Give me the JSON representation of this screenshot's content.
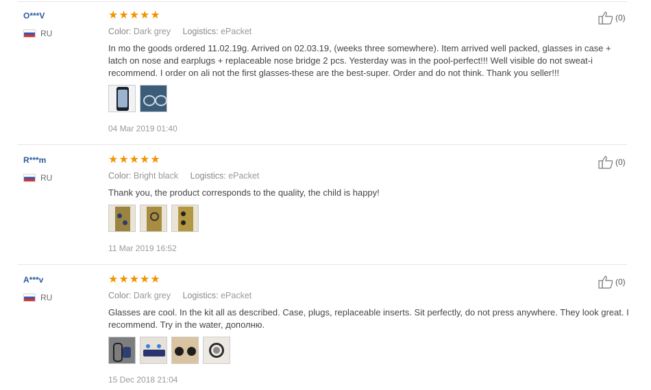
{
  "labels": {
    "color": "Color:",
    "logistics": "Logistics:"
  },
  "reviews": [
    {
      "user": "O***V",
      "country": "RU",
      "rating": "★★★★★",
      "color": "Dark grey",
      "logistics": "ePacket",
      "text": "In mo the goods ordered 11.02.19g. Arrived on 02.03.19, (weeks three somewhere). Item arrived well packed, glasses in case + latch on nose and earplugs + replaceable nose bridge 2 pcs. Yesterday was in the pool-perfect!!! Well visible do not sweat-i recommend. I order on ali not the first glasses-these are the best-super. Order and do not think. Thank you seller!!!",
      "date": "04 Mar 2019 01:40",
      "likes": "(0)"
    },
    {
      "user": "R***m",
      "country": "RU",
      "rating": "★★★★★",
      "color": "Bright black",
      "logistics": "ePacket",
      "text": "Thank you, the product corresponds to the quality, the child is happy!",
      "date": "11 Mar 2019 16:52",
      "likes": "(0)"
    },
    {
      "user": "A***v",
      "country": "RU",
      "rating": "★★★★★",
      "color": "Dark grey",
      "logistics": "ePacket",
      "text": "Glasses are cool. In the kit all as described. Case, plugs, replaceable inserts. Sit perfectly, do not press anywhere. They look great. I recommend. Try in the water, дополню.",
      "date": "15 Dec 2018 21:04",
      "likes": "(0)"
    }
  ]
}
